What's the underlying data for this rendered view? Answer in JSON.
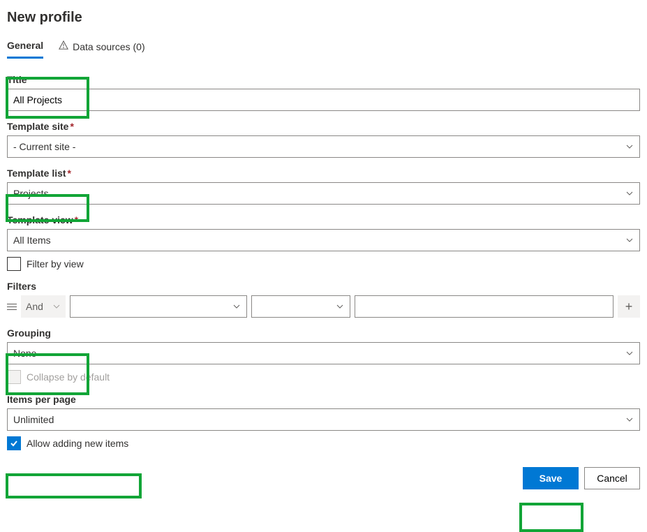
{
  "header": {
    "title": "New profile"
  },
  "tabs": {
    "general": "General",
    "data_sources": "Data sources (0)"
  },
  "fields": {
    "title": {
      "label": "Title",
      "value": "All Projects"
    },
    "template_site": {
      "label": "Template site",
      "value": "- Current site -"
    },
    "template_list": {
      "label": "Template list",
      "value": "Projects"
    },
    "template_view": {
      "label": "Template view",
      "value": "All Items"
    },
    "filter_by_view": {
      "label": "Filter by view"
    },
    "filters": {
      "label": "Filters",
      "logic": "And"
    },
    "grouping": {
      "label": "Grouping",
      "value": "None"
    },
    "collapse": {
      "label": "Collapse by default"
    },
    "items_per_page": {
      "label": "Items per page",
      "value": "Unlimited"
    },
    "allow_add": {
      "label": "Allow adding new items"
    }
  },
  "footer": {
    "save": "Save",
    "cancel": "Cancel"
  }
}
